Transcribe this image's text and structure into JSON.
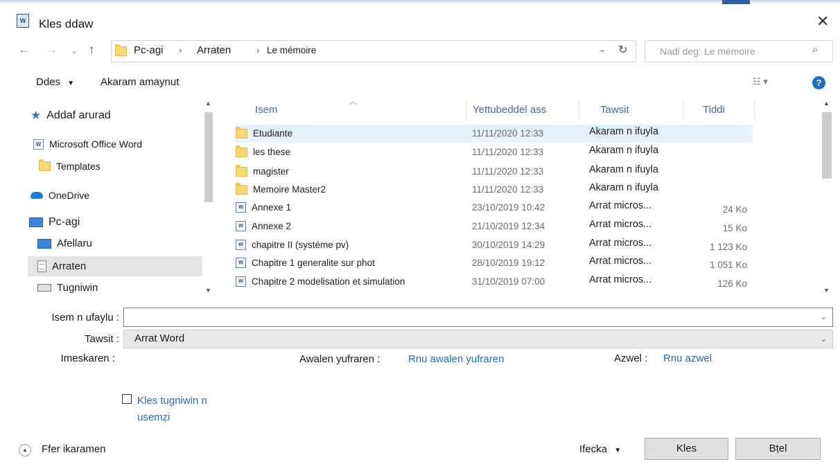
{
  "window": {
    "title": "Kles ddaw",
    "icon": "word-doc-icon",
    "close_glyph": "✕"
  },
  "nav": {
    "back": "←",
    "forward": "→",
    "recent": "⌄",
    "up": "↑",
    "breadcrumbs": [
      "Pc-agi",
      "Arraten",
      "Le mémoire"
    ],
    "sep": "›",
    "history": "⌄",
    "refresh": "↻",
    "search_placeholder": "Nadi deg: Le mémoire",
    "search_glyph": "⌕"
  },
  "toolbar": {
    "organize": "Ddes",
    "new_folder": "Akaram amaynut",
    "view_glyph": "☷ ▾",
    "help_glyph": "?"
  },
  "sidebar": {
    "items": [
      {
        "label": "Addaf arurad",
        "icon": "star-icon"
      },
      {
        "label": "Microsoft Office Word",
        "icon": "word-icon"
      },
      {
        "label": "Templates",
        "icon": "folder-icon"
      },
      {
        "label": "OneDrive",
        "icon": "cloud-icon"
      },
      {
        "label": "Pc-agi",
        "icon": "computer-icon"
      },
      {
        "label": "Afellaru",
        "icon": "desktop-icon"
      },
      {
        "label": "Arraten",
        "icon": "documents-icon"
      },
      {
        "label": "Tugniwin",
        "icon": "drive-icon"
      }
    ]
  },
  "files": {
    "columns": [
      "Isem",
      "Yettubeddel ass",
      "Tawsit",
      "Tiddi"
    ],
    "rows": [
      {
        "name": "Etudiante",
        "date": "11/11/2020 12:33",
        "type": "Akaram n ifuyla",
        "size": "",
        "kind": "folder"
      },
      {
        "name": "les these",
        "date": "11/11/2020 12:33",
        "type": "Akaram n ifuyla",
        "size": "",
        "kind": "folder"
      },
      {
        "name": "magister",
        "date": "11/11/2020 12:33",
        "type": "Akaram n ifuyla",
        "size": "",
        "kind": "folder"
      },
      {
        "name": "Memoire Master2",
        "date": "11/11/2020 12:33",
        "type": "Akaram n ifuyla",
        "size": "",
        "kind": "folder"
      },
      {
        "name": "Annexe 1",
        "date": "23/10/2019 10:42",
        "type": "Arrat micros...",
        "size": "24 Ko",
        "kind": "doc"
      },
      {
        "name": "Annexe 2",
        "date": "21/10/2019 12:34",
        "type": "Arrat micros...",
        "size": "15 Ko",
        "kind": "doc"
      },
      {
        "name": "chapitre  II (systéme pv)",
        "date": "30/10/2019 14:29",
        "type": "Arrat micros...",
        "size": "1 123 Ko",
        "kind": "doc"
      },
      {
        "name": "Chapitre 1 generalite sur phot",
        "date": "28/10/2019 19:12",
        "type": "Arrat micros...",
        "size": "1 051 Ko",
        "kind": "doc"
      },
      {
        "name": "Chapitre 2 modelisation et simulation",
        "date": "31/10/2019 07:00",
        "type": "Arrat micros...",
        "size": "126 Ko",
        "kind": "doc"
      }
    ]
  },
  "form": {
    "filename_label": "Isem n ufaylu :",
    "filename_value": "",
    "filetype_label": "Tawsit :",
    "filetype_value": "Arrat Word",
    "tags_label": "Imeskaren :",
    "authors_label": "Awalen yufraren :",
    "authors_link": "Rnu awalen yufraren",
    "title_label": "Azwel :",
    "title_link": "Rnu azwel",
    "thumbnail_label": "Kles tugniwin n usemẓi"
  },
  "footer": {
    "hide_folders": "Ffer ikaramen",
    "tools": "Ifecka",
    "save": "Kles",
    "cancel": "Bṭel"
  },
  "colors": {
    "accent": "#2a69b8",
    "header_text": "#4a6aa5",
    "selection": "#e5f1fb",
    "folder": "#f8d874"
  }
}
